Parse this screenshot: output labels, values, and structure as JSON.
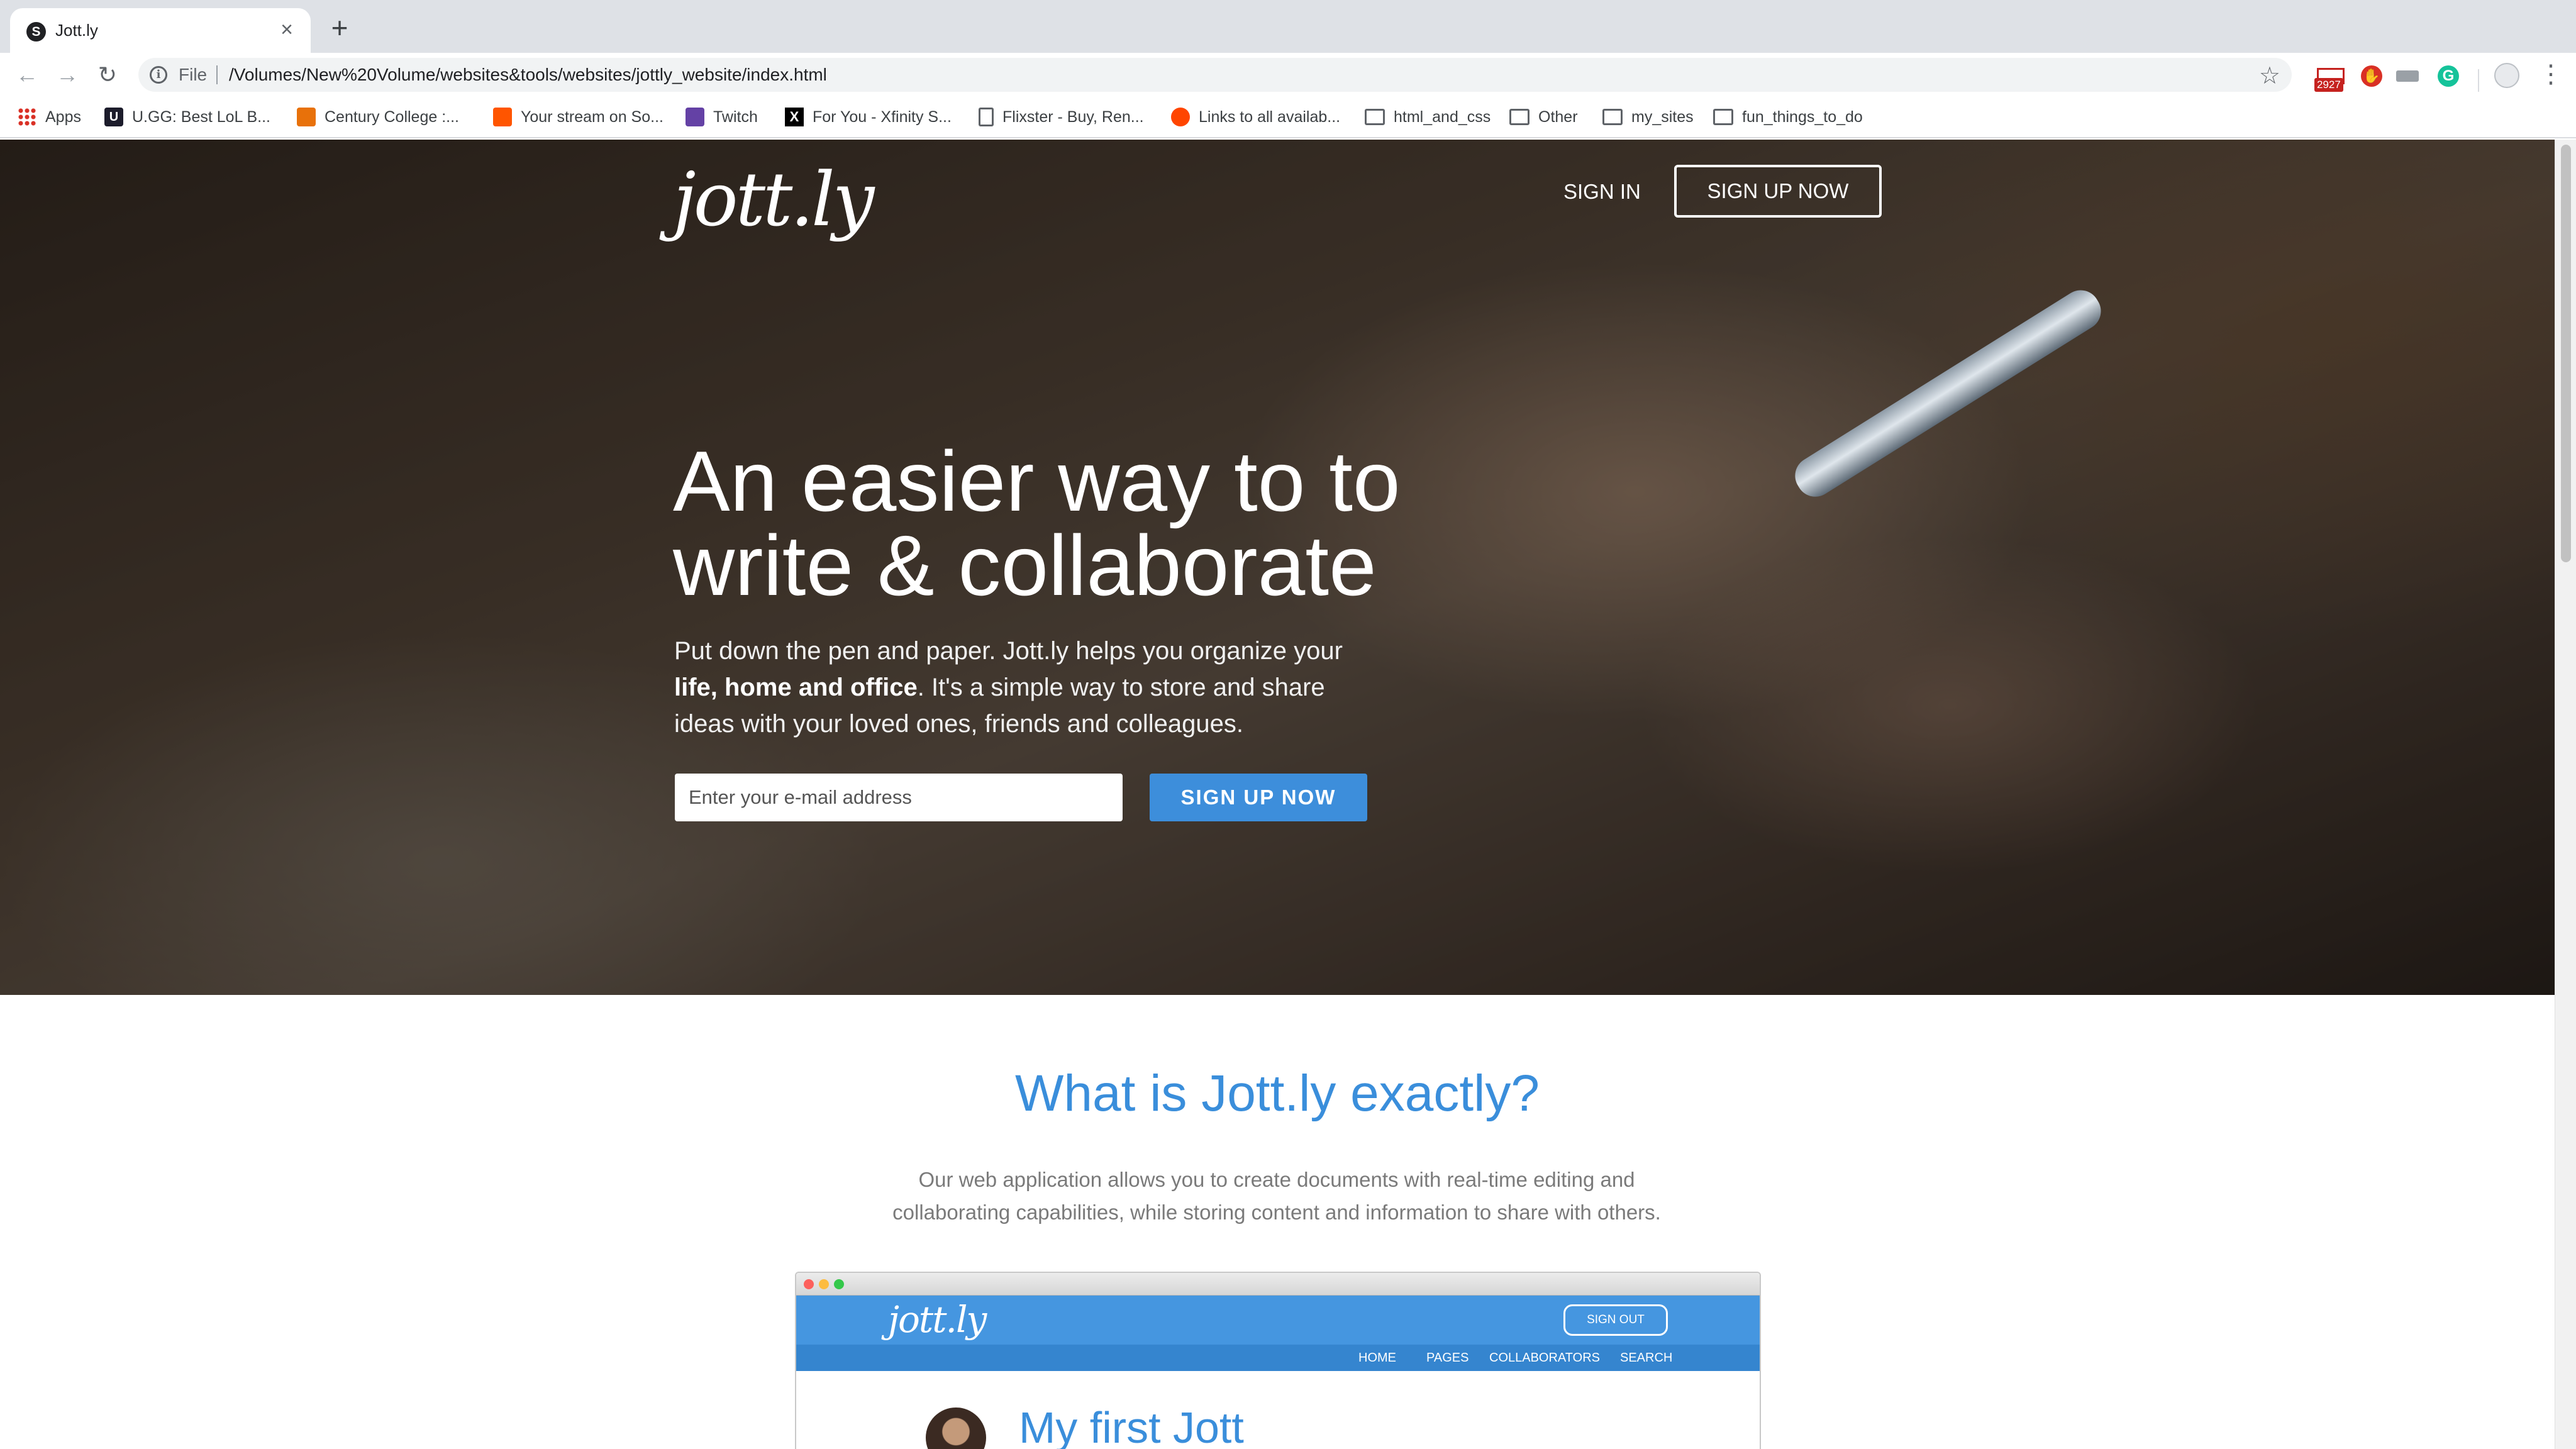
{
  "browser": {
    "tab_title": "Jott.ly",
    "tab_favicon": "S",
    "new_tab": "+",
    "close": "×",
    "omnibox_scheme": "File",
    "url": "/Volumes/New%20Volume/websites&tools/websites/jottly_website/index.html",
    "gmail_badge": "2927",
    "bookmarks": [
      {
        "label": "Apps",
        "icon": "apps-grid-icon"
      },
      {
        "label": "U.GG: Best LoL B...",
        "icon": "ugg-icon"
      },
      {
        "label": "Century College :...",
        "icon": "century-college-icon"
      },
      {
        "label": "Your stream on So...",
        "icon": "soundcloud-icon"
      },
      {
        "label": "Twitch",
        "icon": "twitch-icon"
      },
      {
        "label": "For You - Xfinity S...",
        "icon": "xfinity-icon"
      },
      {
        "label": "Flixster - Buy, Ren...",
        "icon": "page-icon"
      },
      {
        "label": "Links to all availab...",
        "icon": "reddit-icon"
      },
      {
        "label": "html_and_css",
        "icon": "folder-icon"
      },
      {
        "label": "Other",
        "icon": "folder-icon"
      },
      {
        "label": "my_sites",
        "icon": "folder-icon"
      },
      {
        "label": "fun_things_to_do",
        "icon": "folder-icon"
      }
    ]
  },
  "hero": {
    "logo": "jott.ly",
    "signin": "SIGN IN",
    "signup_top": "SIGN UP NOW",
    "headline_line1": "An easier way to to",
    "headline_line2": "write & collaborate",
    "sub_part1": "Put down the pen and paper. Jott.ly helps you organize your ",
    "sub_bold": "life, home and office",
    "sub_part2": ". It's a simple way to store and share ideas with your loved ones, friends and colleagues.",
    "email_placeholder": "Enter your e-mail address",
    "signup_main": "SIGN UP NOW"
  },
  "what": {
    "title": "What is Jott.ly exactly?",
    "description": "Our web application allows you to create documents with real-time editing and collaborating capabilities, while storing content and information to share with others."
  },
  "mockup": {
    "logo": "jott.ly",
    "signout": "SIGN OUT",
    "nav": [
      "HOME",
      "PAGES",
      "COLLABORATORS",
      "SEARCH"
    ],
    "heading": "My first Jott"
  },
  "colors": {
    "accent_blue": "#3a8edb",
    "button_blue": "#3d8edb",
    "mock_header": "#4596e0"
  }
}
